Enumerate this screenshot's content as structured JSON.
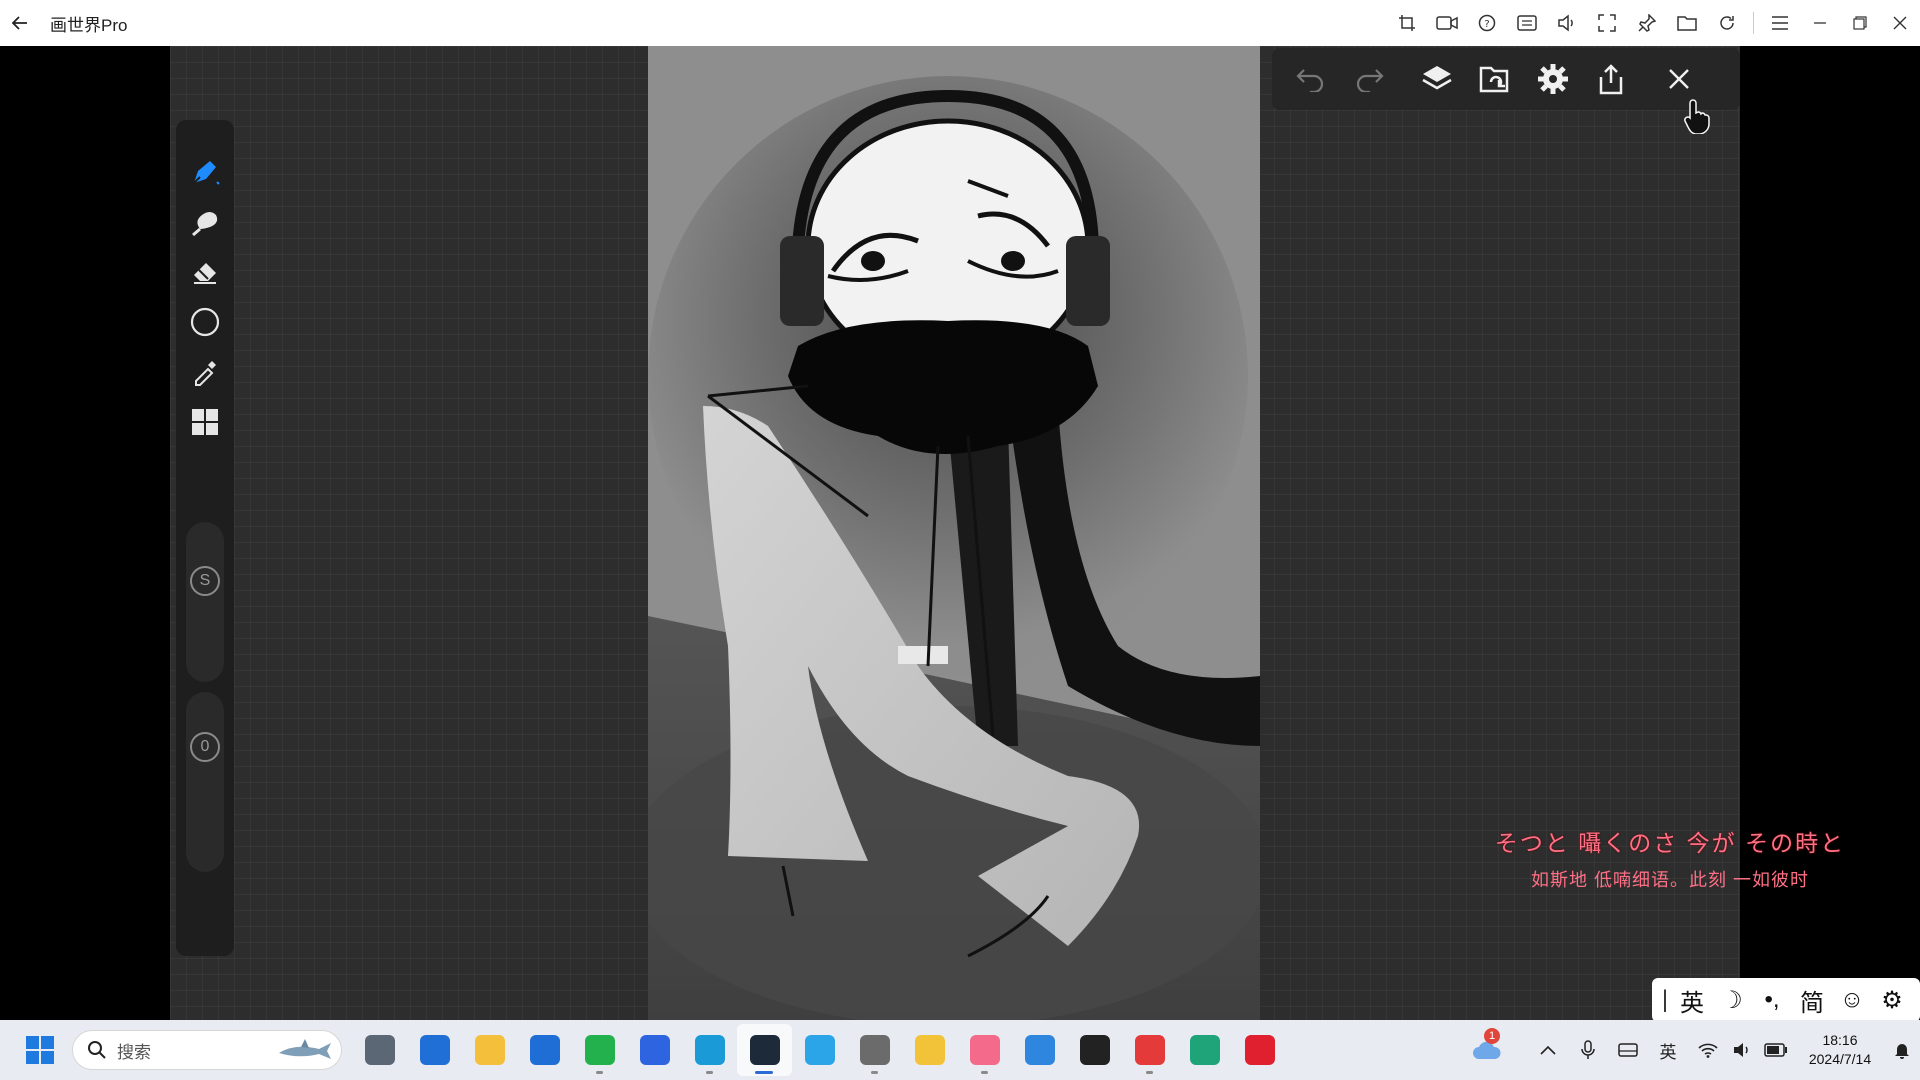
{
  "window": {
    "title": "画世界Pro"
  },
  "titlebar_tools": [
    "crop-icon",
    "record-video-icon",
    "help-icon",
    "keyboard-icon",
    "volume-icon",
    "fullscreen-icon",
    "pin-icon",
    "folder-icon",
    "rotate-icon",
    "menu-icon",
    "minimize-icon",
    "restore-icon",
    "close-icon"
  ],
  "rail": {
    "tools": [
      "brush-icon",
      "smudge-icon",
      "eraser-icon",
      "shape-icon",
      "eyedropper-icon",
      "grid-icon"
    ],
    "size_label": "S",
    "opacity_label": "0"
  },
  "topbar": {
    "buttons": [
      "undo-icon",
      "redo-icon",
      "layers-icon",
      "import-icon",
      "settings-icon",
      "share-icon",
      "close-icon"
    ]
  },
  "lyrics": {
    "line1": "そつと 囁くのさ 今が その時と",
    "line2": "如斯地 低喃细语。此刻 一如彼时"
  },
  "ime": {
    "items": [
      "英",
      "简"
    ]
  },
  "taskbar": {
    "search_placeholder": "搜索",
    "clock_time": "18:16",
    "clock_date": "2024/7/14",
    "tray_lang": "英",
    "weather_badge": "1",
    "apps": [
      {
        "name": "task-view",
        "color": "#5b6775"
      },
      {
        "name": "microsoft-store",
        "color": "#1f6fd6"
      },
      {
        "name": "file-explorer",
        "color": "#f4bf3a"
      },
      {
        "name": "mybp-app",
        "color": "#1e6ed6"
      },
      {
        "name": "wechat",
        "color": "#22b14c"
      },
      {
        "name": "blue-app",
        "color": "#2f64e0"
      },
      {
        "name": "edge",
        "color": "#1a9bd8"
      },
      {
        "name": "painter-app",
        "color": "#1d2a3a"
      },
      {
        "name": "browser-help",
        "color": "#2ca4e8"
      },
      {
        "name": "copilot-robot",
        "color": "#6b6b6b"
      },
      {
        "name": "folder",
        "color": "#f2c339"
      },
      {
        "name": "bilibili",
        "color": "#f36a8a"
      },
      {
        "name": "globe-app",
        "color": "#2e86de"
      },
      {
        "name": "qq",
        "color": "#222222"
      },
      {
        "name": "netease-music",
        "color": "#e43a3a"
      },
      {
        "name": "green-app",
        "color": "#1fa47a"
      },
      {
        "name": "opera",
        "color": "#e01f2f"
      }
    ]
  }
}
